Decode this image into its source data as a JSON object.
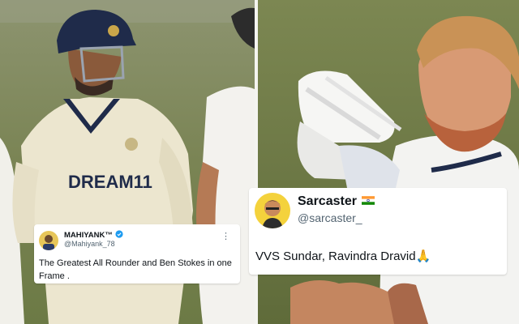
{
  "left_tweet": {
    "display_name": "MAHIYANK™",
    "handle": "@Mahiyank_78",
    "text": "The Greatest All Rounder and Ben Stokes in one Frame  .",
    "more_glyph": "⋮",
    "icons": [
      "avatar",
      "verified-badge-icon",
      "more-options-icon"
    ]
  },
  "right_tweet": {
    "display_name": "Sarcaster",
    "handle": "@sarcaster_",
    "text": "VVS Sundar, Ravindra Dravid🙏",
    "icons": [
      "avatar",
      "india-flag-icon"
    ]
  },
  "jersey_text": "DREAM11",
  "colors": {
    "india_jersey": "#ece6cf",
    "helmet_navy": "#1f2b4a",
    "verified_blue": "#1d9bf0",
    "avatar_yellow": "#f4d23c"
  }
}
